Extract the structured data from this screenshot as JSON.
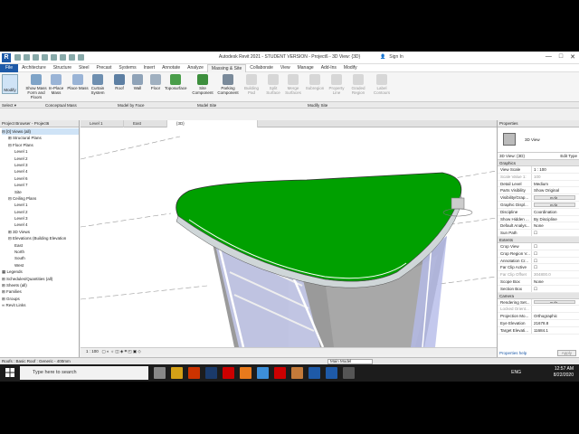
{
  "window": {
    "title": "Autodesk Revit 2021 - STUDENT VERSION - Project6 - 3D View: {3D}",
    "search_placeholder": "Sign In",
    "controls": [
      "—",
      "□",
      "✕"
    ]
  },
  "menu": {
    "tabs": [
      "File",
      "Architecture",
      "Structure",
      "Steel",
      "Precast",
      "Systems",
      "Insert",
      "Annotate",
      "Analyze",
      "Massing & Site",
      "Collaborate",
      "View",
      "Manage",
      "Add-Ins",
      "Modify"
    ],
    "active_tab": "Massing & Site"
  },
  "ribbon": {
    "modify_label": "Modify",
    "buttons": [
      {
        "label": "Show Mass Form and Floors",
        "color": "#7fa4c8",
        "disabled": false
      },
      {
        "label": "In-Place Mass",
        "color": "#9ab4d6",
        "disabled": false
      },
      {
        "label": "Place Mass",
        "color": "#9ab4d6",
        "disabled": false
      },
      {
        "label": "Curtain System",
        "color": "#6e8fb0",
        "disabled": false
      },
      {
        "label": "Roof",
        "color": "#5d7fa3",
        "disabled": false
      },
      {
        "label": "Wall",
        "color": "#8fa3b8",
        "disabled": false
      },
      {
        "label": "Floor",
        "color": "#a0b0c0",
        "disabled": false
      },
      {
        "label": "Toposurface",
        "color": "#4a9e4a",
        "disabled": false
      },
      {
        "label": "Site Component",
        "color": "#3d8f3d",
        "disabled": false
      },
      {
        "label": "Parking Component",
        "color": "#7a8a9a",
        "disabled": false
      },
      {
        "label": "Building Pad",
        "color": "#aaaaaa",
        "disabled": true
      },
      {
        "label": "Split Surface",
        "color": "#aaaaaa",
        "disabled": true
      },
      {
        "label": "Merge Surfaces",
        "color": "#aaaaaa",
        "disabled": true
      },
      {
        "label": "Subregion",
        "color": "#aaaaaa",
        "disabled": true
      },
      {
        "label": "Property Line",
        "color": "#aaaaaa",
        "disabled": true
      },
      {
        "label": "Graded Region",
        "color": "#aaaaaa",
        "disabled": true
      },
      {
        "label": "Label Contours",
        "color": "#aaaaaa",
        "disabled": true
      }
    ],
    "panels": [
      "Select ▾",
      "Conceptual Mass",
      "Model by Face",
      "Model Site",
      "Modify Site"
    ]
  },
  "project_browser": {
    "header": "Project Browser - Project6",
    "items": [
      {
        "text": "⊟ [0] Views (all)",
        "indent": 0,
        "highlight": true
      },
      {
        "text": "⊞ Structural Plans",
        "indent": 1
      },
      {
        "text": "⊟ Floor Plans",
        "indent": 1
      },
      {
        "text": "Level 1",
        "indent": 2
      },
      {
        "text": "Level 2",
        "indent": 2
      },
      {
        "text": "Level 3",
        "indent": 2
      },
      {
        "text": "Level 4",
        "indent": 2
      },
      {
        "text": "Level 6",
        "indent": 2
      },
      {
        "text": "Level 7",
        "indent": 2
      },
      {
        "text": "Site",
        "indent": 2
      },
      {
        "text": "⊟ Ceiling Plans",
        "indent": 1
      },
      {
        "text": "Level 1",
        "indent": 2
      },
      {
        "text": "Level 2",
        "indent": 2
      },
      {
        "text": "Level 3",
        "indent": 2
      },
      {
        "text": "Level 4",
        "indent": 2
      },
      {
        "text": "⊞ 3D Views",
        "indent": 1
      },
      {
        "text": "⊟ Elevations (Building Elevation",
        "indent": 1
      },
      {
        "text": "East",
        "indent": 2
      },
      {
        "text": "North",
        "indent": 2
      },
      {
        "text": "South",
        "indent": 2
      },
      {
        "text": "West",
        "indent": 2
      },
      {
        "text": "▦ Legends",
        "indent": 0
      },
      {
        "text": "⊞ Schedules/Quantities (all)",
        "indent": 0
      },
      {
        "text": "⊞ Sheets (all)",
        "indent": 0
      },
      {
        "text": "⊞ Families",
        "indent": 0
      },
      {
        "text": "⊞ Groups",
        "indent": 0
      },
      {
        "text": "∞ Revit Links",
        "indent": 0
      }
    ]
  },
  "view_tabs": [
    {
      "label": "Level 1",
      "active": false
    },
    {
      "label": "East",
      "active": false
    },
    {
      "label": "{3D}",
      "active": true
    }
  ],
  "view_bar": {
    "scale": "1 : 100",
    "icons": "▢ ◐ ☼ ◫ ◈ ⌗ ◰ ▣ ◇"
  },
  "properties": {
    "header": "Properties",
    "type_label": "3D View",
    "selector": "3D View: {3D}",
    "edit_type": "Edit Type",
    "sections": [
      {
        "title": "Graphics",
        "rows": [
          {
            "k": "View Scale",
            "v": "1 : 100",
            "btn": false,
            "disabled": false
          },
          {
            "k": "Scale Value  1:",
            "v": "100",
            "btn": false,
            "disabled": true
          },
          {
            "k": "Detail Level",
            "v": "Medium",
            "btn": false,
            "disabled": false
          },
          {
            "k": "Parts Visibility",
            "v": "Show Original",
            "btn": false,
            "disabled": false
          },
          {
            "k": "Visibility/Grap...",
            "v": "Edit...",
            "btn": true,
            "disabled": false
          },
          {
            "k": "Graphic Displ...",
            "v": "Edit...",
            "btn": true,
            "disabled": false
          },
          {
            "k": "Discipline",
            "v": "Coordination",
            "btn": false,
            "disabled": false
          },
          {
            "k": "Show Hidden ...",
            "v": "By Discipline",
            "btn": false,
            "disabled": false
          },
          {
            "k": "Default Analys...",
            "v": "None",
            "btn": false,
            "disabled": false
          },
          {
            "k": "Sun Path",
            "v": "☐",
            "btn": false,
            "disabled": false
          }
        ]
      },
      {
        "title": "Extents",
        "rows": [
          {
            "k": "Crop View",
            "v": "☐",
            "btn": false,
            "disabled": false
          },
          {
            "k": "Crop Region V...",
            "v": "☐",
            "btn": false,
            "disabled": false
          },
          {
            "k": "Annotation Cr...",
            "v": "☐",
            "btn": false,
            "disabled": false
          },
          {
            "k": "Far Clip Active",
            "v": "☐",
            "btn": false,
            "disabled": false
          },
          {
            "k": "Far Clip Offset",
            "v": "304800.0",
            "btn": false,
            "disabled": true
          },
          {
            "k": "Scope Box",
            "v": "None",
            "btn": false,
            "disabled": false
          },
          {
            "k": "Section Box",
            "v": "☐",
            "btn": false,
            "disabled": false
          }
        ]
      },
      {
        "title": "Camera",
        "rows": [
          {
            "k": "Rendering Set...",
            "v": "Edit...",
            "btn": true,
            "disabled": false
          },
          {
            "k": "Locked Orient...",
            "v": "",
            "btn": false,
            "disabled": true
          },
          {
            "k": "Projection Mo...",
            "v": "Orthographic",
            "btn": false,
            "disabled": false
          },
          {
            "k": "Eye Elevation",
            "v": "21678.8",
            "btn": false,
            "disabled": false
          },
          {
            "k": "Target Elevati...",
            "v": "11684.1",
            "btn": false,
            "disabled": false
          }
        ]
      }
    ],
    "help_link": "Properties help",
    "apply": "Apply"
  },
  "status": {
    "text": "Roofs : Basic Roof : Generic - 400mm",
    "model": "Main Model"
  },
  "taskbar": {
    "search_placeholder": "Type here to search",
    "time": "12:57 AM",
    "date": "8/22/2020",
    "lang": "ENG",
    "app_colors": [
      "#888888",
      "#d4a017",
      "#cc3300",
      "#1a3a6a",
      "#cc0000",
      "#e87a1c",
      "#3d8fd9",
      "#cc0000",
      "#c47a3a",
      "#1e5aa8",
      "#1e5aa8",
      "#555555"
    ]
  }
}
